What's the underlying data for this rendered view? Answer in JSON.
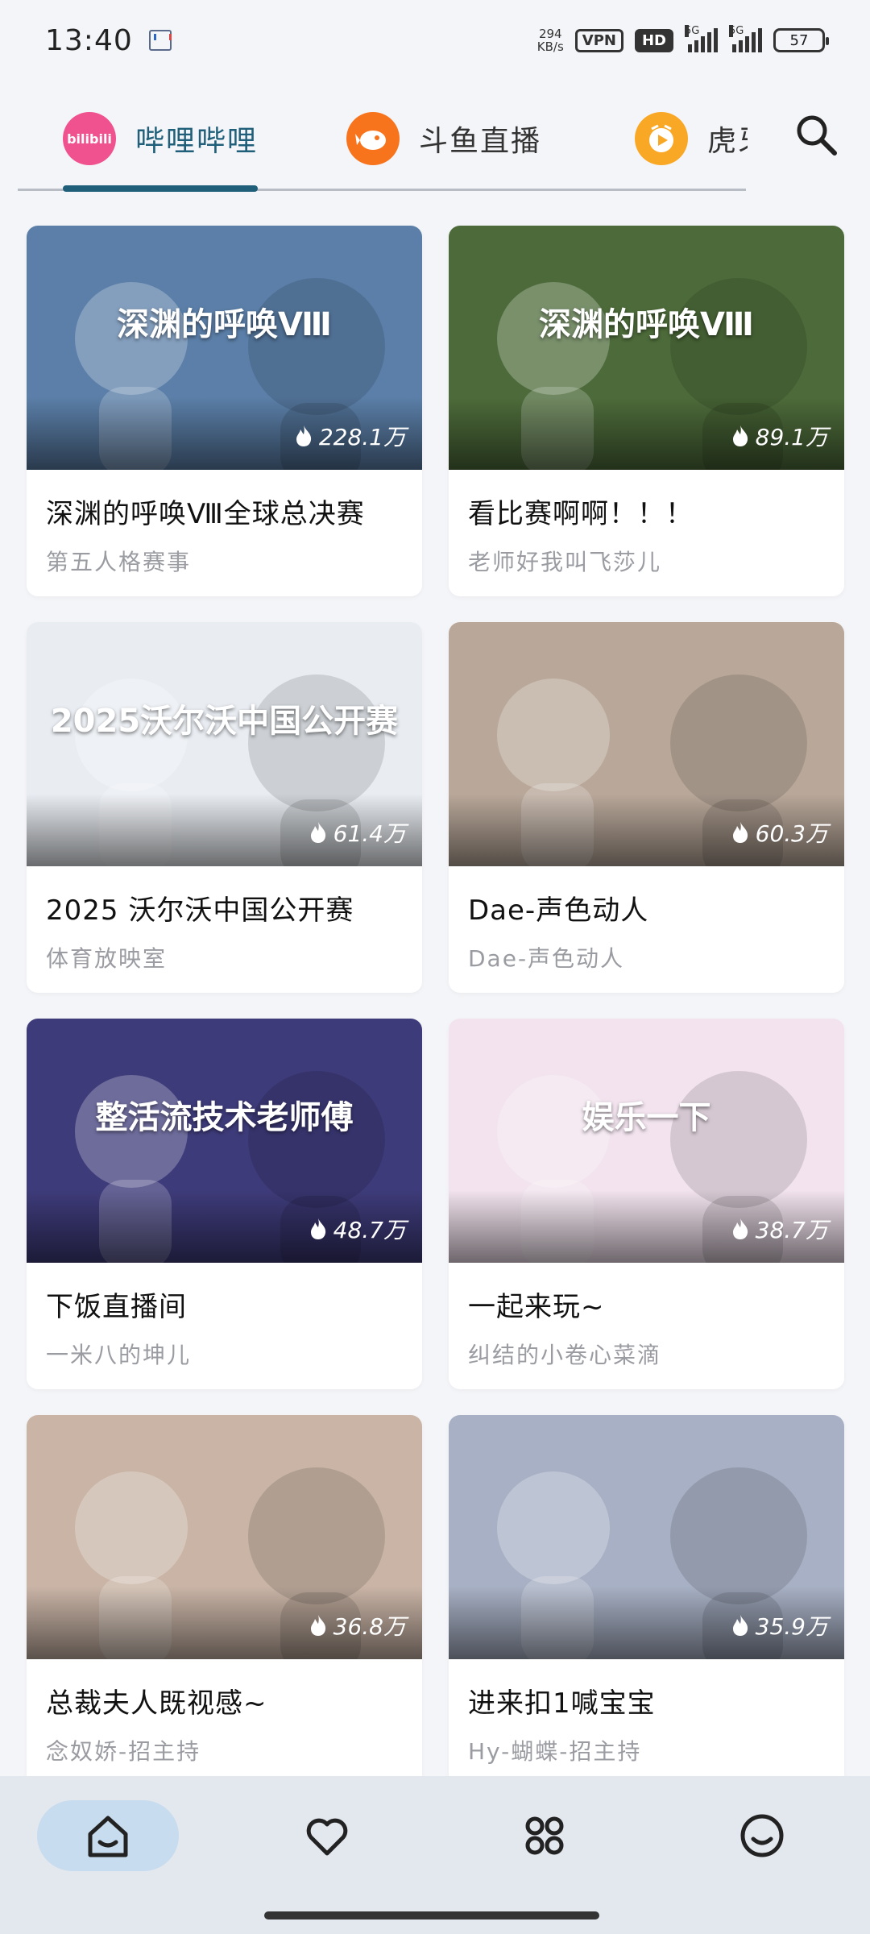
{
  "status_bar": {
    "time": "13:40",
    "net_speed_value": "294",
    "net_speed_unit": "KB/s",
    "vpn": "VPN",
    "hd": "HD",
    "signal_1": "5G",
    "signal_2": "5G",
    "battery": "57"
  },
  "platform_tabs": [
    {
      "label": "哔哩哔哩",
      "logo_text": "bilibili",
      "active": true
    },
    {
      "label": "斗鱼直播",
      "logo_text": "",
      "active": false
    },
    {
      "label": "虎牙",
      "logo_text": "",
      "active": false
    }
  ],
  "colors": {
    "accent": "#1f5f7a",
    "nav_active_bg": "#c7dcef",
    "background": "#f4f5f8"
  },
  "streams": [
    {
      "title": "深渊的呼唤Ⅷ全球总决赛",
      "streamer": "第五人格赛事",
      "viewers": "228.1万",
      "thumb_text": "深渊的呼唤Ⅷ",
      "thumb_bg": "#5b7fa8"
    },
    {
      "title": "看比赛啊啊！！！",
      "streamer": "老师好我叫飞莎儿",
      "viewers": "89.1万",
      "thumb_text": "深渊的呼唤Ⅷ",
      "thumb_bg": "#4d6b3a"
    },
    {
      "title": "2025 沃尔沃中国公开赛",
      "streamer": "体育放映室",
      "viewers": "61.4万",
      "thumb_text": "2025沃尔沃中国公开赛",
      "thumb_bg": "#e9edf2"
    },
    {
      "title": "Dae-声色动人",
      "streamer": "Dae-声色动人",
      "viewers": "60.3万",
      "thumb_text": "",
      "thumb_bg": "#b9a89a"
    },
    {
      "title": "下饭直播间",
      "streamer": "一米八的坤儿",
      "viewers": "48.7万",
      "thumb_text": "整活流技术老师傅",
      "thumb_bg": "#3e3b7a"
    },
    {
      "title": "一起来玩~",
      "streamer": "纠结的小卷心菜滴",
      "viewers": "38.7万",
      "thumb_text": "娱乐一下",
      "thumb_bg": "#f2e3ee"
    },
    {
      "title": "总裁夫人既视感~",
      "streamer": "念奴娇-招主持",
      "viewers": "36.8万",
      "thumb_text": "",
      "thumb_bg": "#c9b4a6"
    },
    {
      "title": "进来扣1喊宝宝",
      "streamer": "Hy-蝴蝶-招主持",
      "viewers": "35.9万",
      "thumb_text": "",
      "thumb_bg": "#a7b0c4"
    }
  ],
  "bottom_nav": [
    {
      "icon": "home-icon",
      "active": true
    },
    {
      "icon": "heart-icon",
      "active": false
    },
    {
      "icon": "grid-icon",
      "active": false
    },
    {
      "icon": "smile-icon",
      "active": false
    }
  ]
}
